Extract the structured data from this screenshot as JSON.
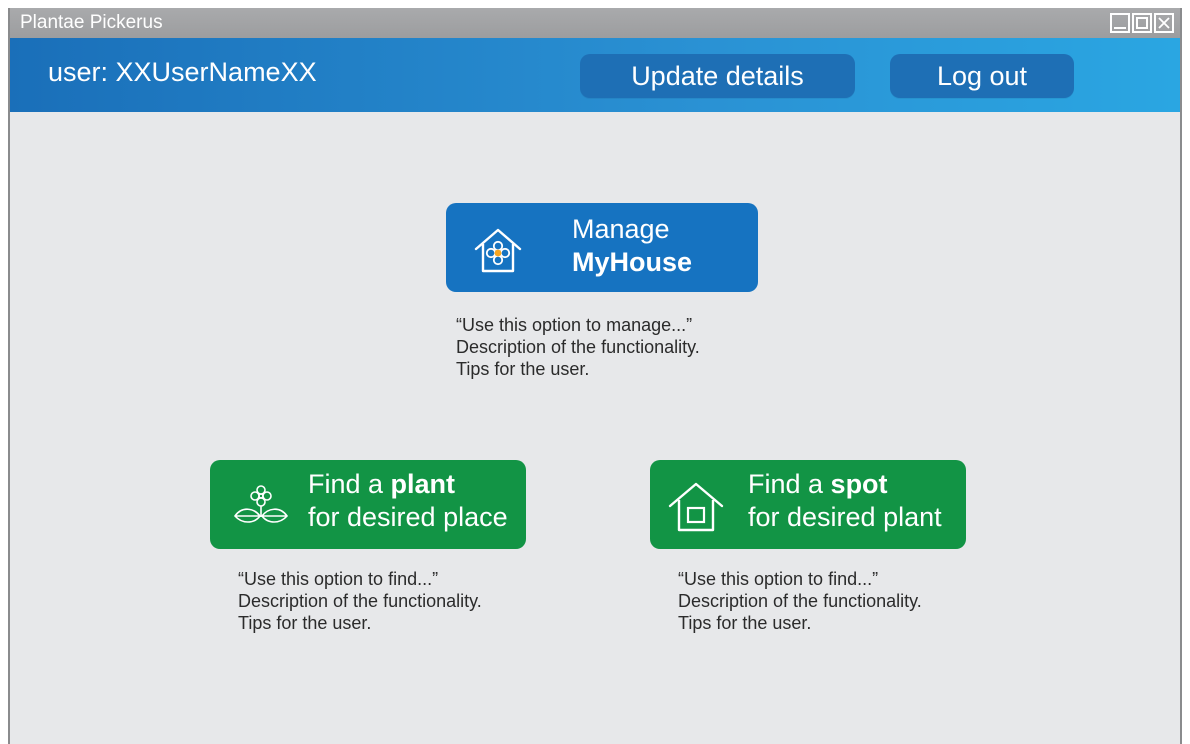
{
  "window": {
    "title": "Plantae Pickerus",
    "controls": [
      "minimize",
      "maximize",
      "close"
    ]
  },
  "header": {
    "user_label": "user: XXUserNameXX",
    "update_label": "Update details",
    "logout_label": "Log out"
  },
  "actions": {
    "manage": {
      "line1": "Manage",
      "line2_bold": "MyHouse",
      "icon": "house-flower-icon",
      "color": "#1673c1",
      "desc": [
        "“Use this option to manage...”",
        "Description of the functionality.",
        "Tips for the user."
      ]
    },
    "find_plant": {
      "line1_prefix": "Find a ",
      "line1_bold": "plant",
      "line2": "for desired place",
      "icon": "flower-leaves-icon",
      "color": "#129445",
      "desc": [
        "“Use this option to find...”",
        "Description of the functionality.",
        "Tips for the user."
      ]
    },
    "find_spot": {
      "line1_prefix": "Find a ",
      "line1_bold": "spot",
      "line2": "for desired plant",
      "icon": "house-window-icon",
      "color": "#129445",
      "desc": [
        "“Use this option to find...”",
        "Description of the functionality.",
        "Tips for the user."
      ]
    }
  },
  "colors": {
    "titlebar": "#a0a1a3",
    "header_start": "#1a6fb9",
    "header_end": "#2aa6e2",
    "background": "#e7e8ea"
  }
}
